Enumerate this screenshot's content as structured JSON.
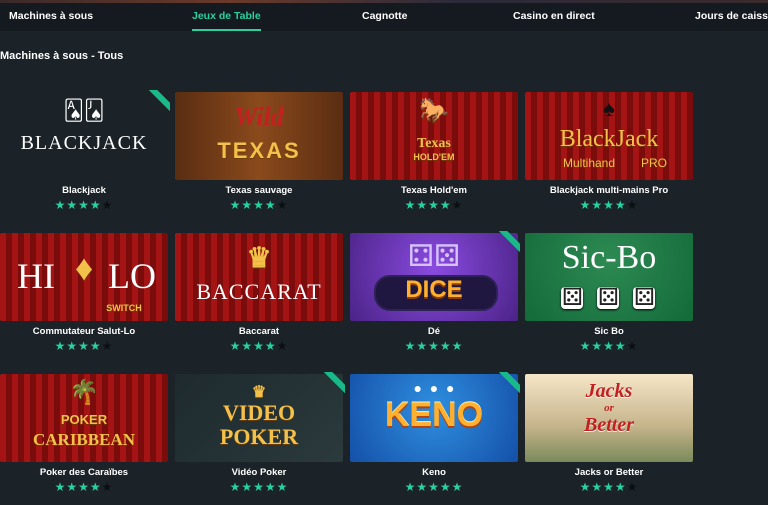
{
  "nav": {
    "tabs": [
      {
        "label": "Machines à sous",
        "active": false
      },
      {
        "label": "Jeux de Table",
        "active": true
      },
      {
        "label": "Cagnotte",
        "active": false
      },
      {
        "label": "Casino en direct",
        "active": false
      },
      {
        "label": "Jours de caisse",
        "active": false
      }
    ]
  },
  "section_title": "Machines à sous - Tous",
  "games": [
    {
      "name": "Blackjack",
      "rating": 4,
      "max_rating": 5,
      "thumb_text": "BLACKJACK",
      "new_ribbon": true
    },
    {
      "name": "Texas sauvage",
      "rating": 4,
      "max_rating": 5,
      "thumb_text": [
        "Wild",
        "TEXAS"
      ],
      "new_ribbon": false
    },
    {
      "name": "Texas Hold'em",
      "rating": 4,
      "max_rating": 5,
      "thumb_text": [
        "Texas",
        "HOLD'EM"
      ],
      "new_ribbon": false
    },
    {
      "name": "Blackjack multi-mains Pro",
      "rating": 4,
      "max_rating": 5,
      "thumb_text": [
        "BlackJack",
        "Multihand",
        "PRO"
      ],
      "new_ribbon": false
    },
    {
      "name": "Commutateur Salut-Lo",
      "rating": 4,
      "max_rating": 5,
      "thumb_text": [
        "HI",
        "LO",
        "SWITCH"
      ],
      "new_ribbon": false
    },
    {
      "name": "Baccarat",
      "rating": 4,
      "max_rating": 5,
      "thumb_text": "BACCARAT",
      "new_ribbon": false
    },
    {
      "name": "Dé",
      "rating": 5,
      "max_rating": 5,
      "thumb_text": "DICE",
      "new_ribbon": true
    },
    {
      "name": "Sic Bo",
      "rating": 4,
      "max_rating": 5,
      "thumb_text": "Sic-Bo",
      "new_ribbon": false
    },
    {
      "name": "Poker des Caraïbes",
      "rating": 4,
      "max_rating": 5,
      "thumb_text": [
        "POKER",
        "CARIBBEAN"
      ],
      "new_ribbon": false
    },
    {
      "name": "Vidéo Poker",
      "rating": 5,
      "max_rating": 5,
      "thumb_text": [
        "VIDEO",
        "POKER"
      ],
      "new_ribbon": true
    },
    {
      "name": "Keno",
      "rating": 5,
      "max_rating": 5,
      "thumb_text": "KENO",
      "new_ribbon": true
    },
    {
      "name": "Jacks or Better",
      "rating": 4,
      "max_rating": 5,
      "thumb_text": [
        "Jacks",
        "or",
        "Better"
      ],
      "new_ribbon": false
    }
  ],
  "colors": {
    "accent": "#28d1a0",
    "background": "#1b2228",
    "nav_background": "#141a1f",
    "star_empty": "#0a0f12"
  }
}
